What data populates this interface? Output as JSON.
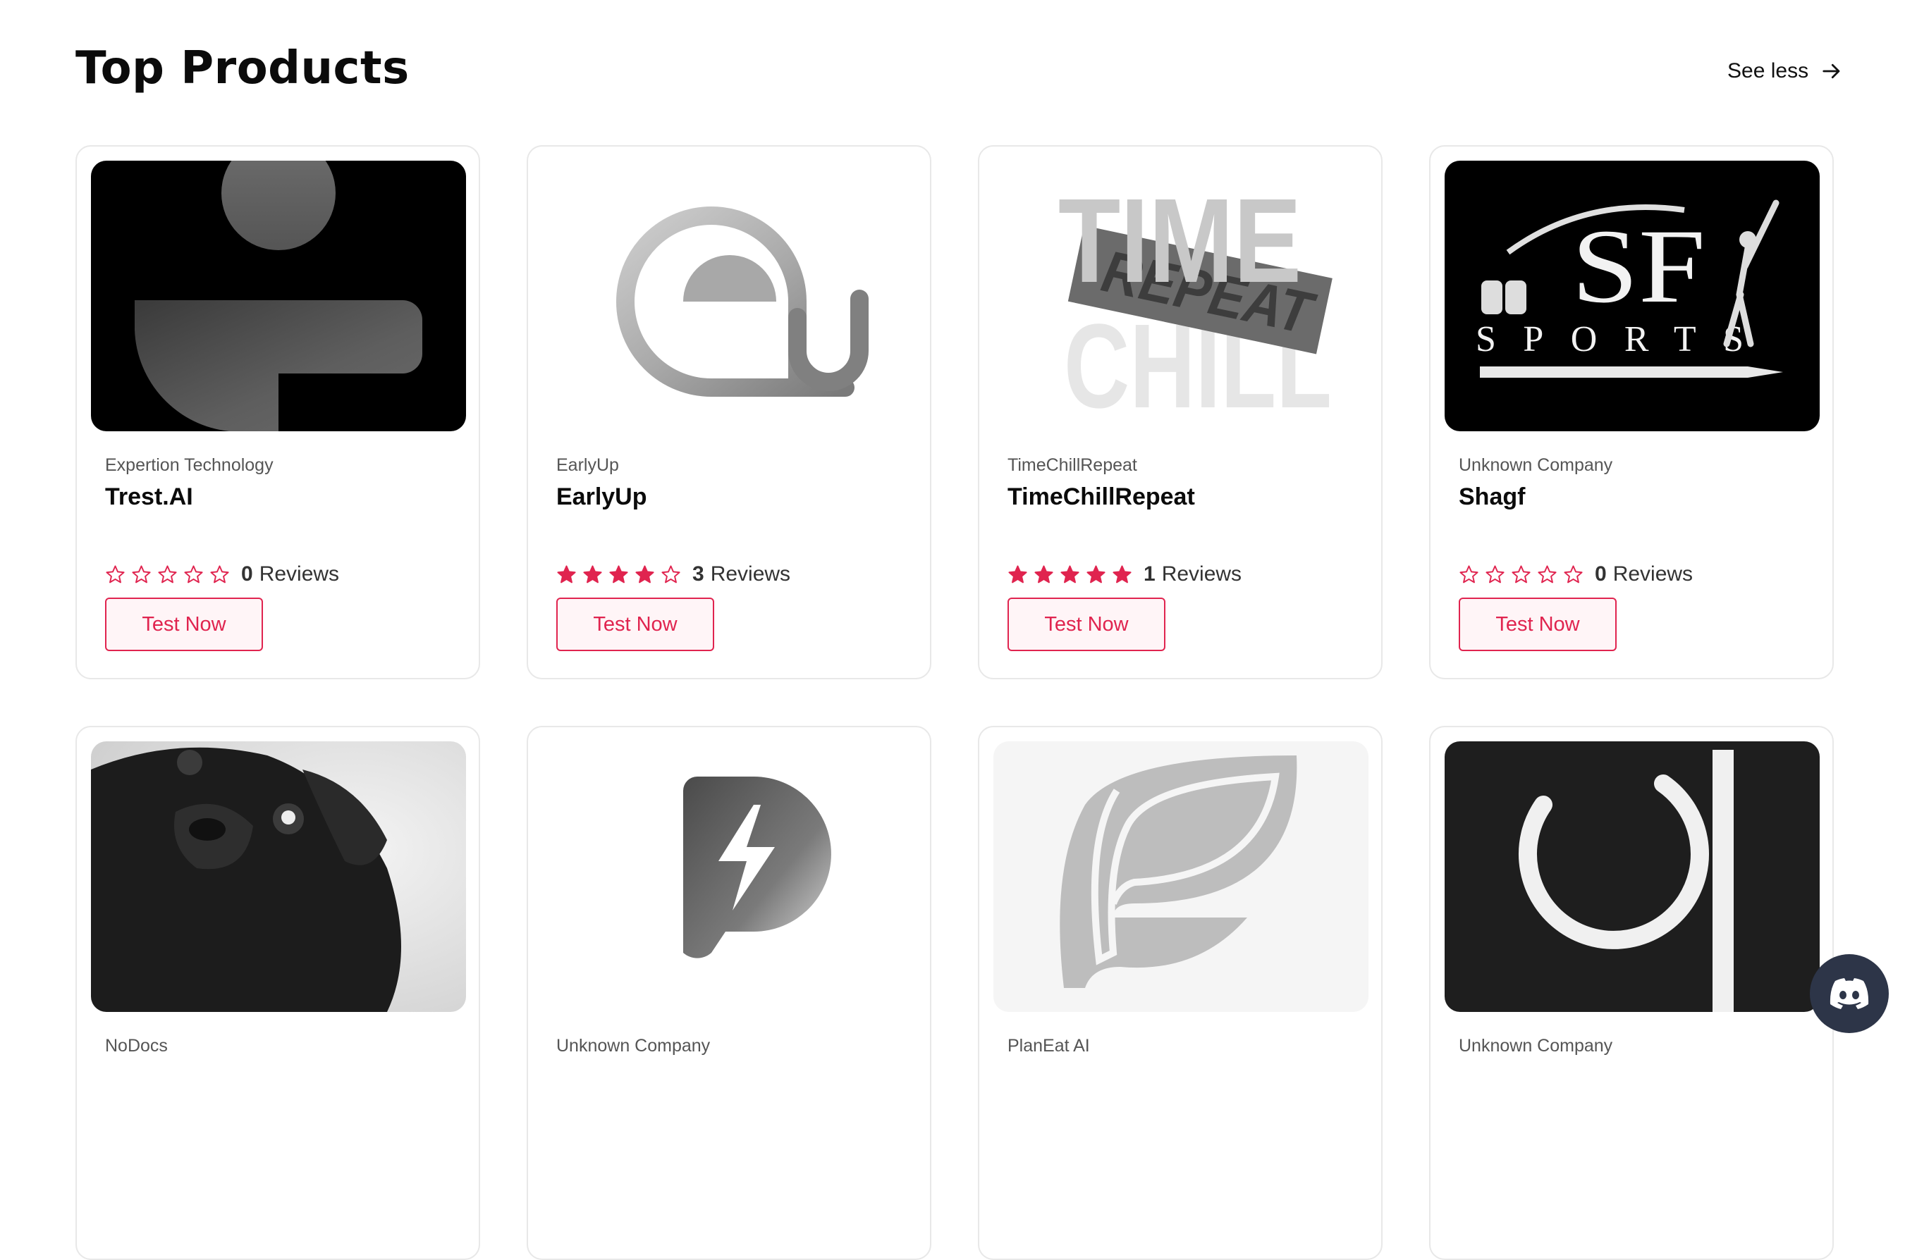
{
  "header": {
    "title": "Top Products",
    "see_less_label": "See less",
    "see_less_icon": "arrow-right-icon"
  },
  "colors": {
    "accent": "#e0244f",
    "star_filled": "#e0244f",
    "discord_bg": "#2d3548"
  },
  "products": [
    {
      "company": "Expertion Technology",
      "name": "Trest.AI",
      "rating": 0,
      "reviews_count": "0",
      "reviews_label": "Reviews",
      "button_label": "Test Now",
      "logo": "trest-ai-logo"
    },
    {
      "company": "EarlyUp",
      "name": "EarlyUp",
      "rating": 4,
      "reviews_count": "3",
      "reviews_label": "Reviews",
      "button_label": "Test Now",
      "logo": "earlyup-logo"
    },
    {
      "company": "TimeChillRepeat",
      "name": "TimeChillRepeat",
      "rating": 5,
      "reviews_count": "1",
      "reviews_label": "Reviews",
      "button_label": "Test Now",
      "logo": "timechillrepeat-logo",
      "logo_text": {
        "line1": "TIME",
        "line2": "REPEAT",
        "line3": "CHILL"
      }
    },
    {
      "company": "Unknown Company",
      "name": "Shagf",
      "rating": 0,
      "reviews_count": "0",
      "reviews_label": "Reviews",
      "button_label": "Test Now",
      "logo": "sf-sports-logo",
      "logo_text": {
        "mark": "SF",
        "word": "SPORTS"
      }
    },
    {
      "company": "NoDocs",
      "logo": "pug-photo"
    },
    {
      "company": "Unknown Company",
      "logo": "bolt-p-logo"
    },
    {
      "company": "PlanEat AI",
      "logo": "planeat-leaf-logo"
    },
    {
      "company": "Unknown Company",
      "logo": "ai-ring-logo"
    }
  ],
  "discord_icon": "discord-icon"
}
